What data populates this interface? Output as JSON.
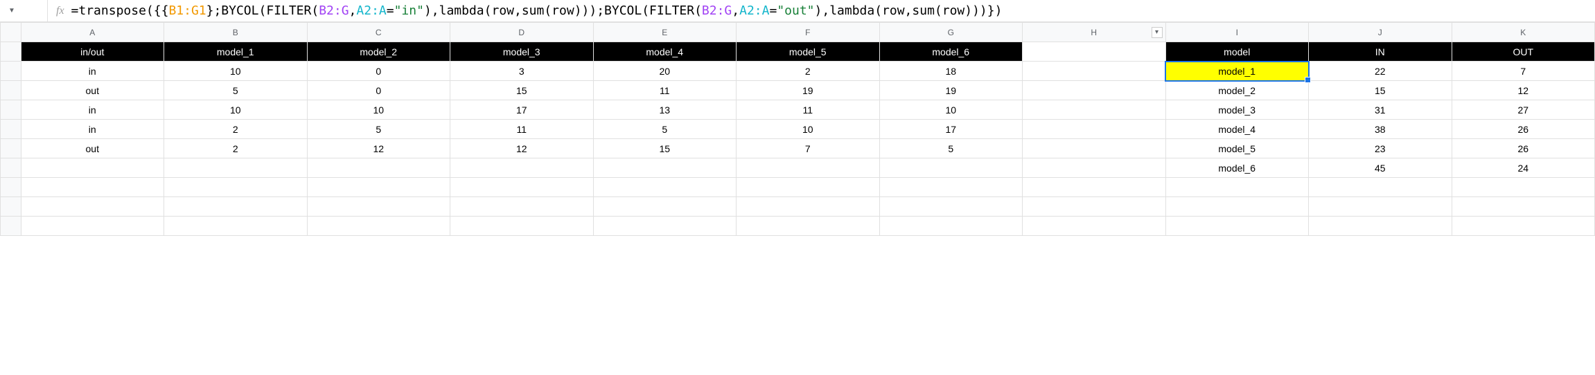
{
  "formula_bar": {
    "fx_label": "fx",
    "tokens": [
      {
        "t": "=transpose({{",
        "c": ""
      },
      {
        "t": "B1:G1",
        "c": "tok-orange"
      },
      {
        "t": "};BYCOL(FILTER(",
        "c": ""
      },
      {
        "t": "B2:G",
        "c": "tok-purple"
      },
      {
        "t": ",",
        "c": ""
      },
      {
        "t": "A2:A",
        "c": "tok-teal"
      },
      {
        "t": "=",
        "c": ""
      },
      {
        "t": "\"in\"",
        "c": "tok-green"
      },
      {
        "t": "),lambda(row,sum(row)));BYCOL(FILTER(",
        "c": ""
      },
      {
        "t": "B2:G",
        "c": "tok-purple"
      },
      {
        "t": ",",
        "c": ""
      },
      {
        "t": "A2:A",
        "c": "tok-teal"
      },
      {
        "t": "=",
        "c": ""
      },
      {
        "t": "\"out\"",
        "c": "tok-green"
      },
      {
        "t": "),lambda(row,sum(row)))})",
        "c": ""
      }
    ]
  },
  "columns": [
    "A",
    "B",
    "C",
    "D",
    "E",
    "F",
    "G",
    "H",
    "I",
    "J",
    "K"
  ],
  "header_row_left": [
    "in/out",
    "model_1",
    "model_2",
    "model_3",
    "model_4",
    "model_5",
    "model_6"
  ],
  "header_row_right": [
    "model",
    "IN",
    "OUT"
  ],
  "data_left": [
    [
      "in",
      "10",
      "0",
      "3",
      "20",
      "2",
      "18"
    ],
    [
      "out",
      "5",
      "0",
      "15",
      "11",
      "19",
      "19"
    ],
    [
      "in",
      "10",
      "10",
      "17",
      "13",
      "11",
      "10"
    ],
    [
      "in",
      "2",
      "5",
      "11",
      "5",
      "10",
      "17"
    ],
    [
      "out",
      "2",
      "12",
      "12",
      "15",
      "7",
      "5"
    ]
  ],
  "data_right": [
    [
      "model_1",
      "22",
      "7"
    ],
    [
      "model_2",
      "15",
      "12"
    ],
    [
      "model_3",
      "31",
      "27"
    ],
    [
      "model_4",
      "38",
      "26"
    ],
    [
      "model_5",
      "23",
      "26"
    ],
    [
      "model_6",
      "45",
      "24"
    ]
  ],
  "active_cell": {
    "row": 0,
    "col": 0,
    "side": "right"
  },
  "chart_data": {
    "type": "table",
    "title": "in/out totals by model",
    "columns": [
      "model",
      "IN",
      "OUT"
    ],
    "rows": [
      {
        "model": "model_1",
        "IN": 22,
        "OUT": 7
      },
      {
        "model": "model_2",
        "IN": 15,
        "OUT": 12
      },
      {
        "model": "model_3",
        "IN": 31,
        "OUT": 27
      },
      {
        "model": "model_4",
        "IN": 38,
        "OUT": 26
      },
      {
        "model": "model_5",
        "IN": 23,
        "OUT": 26
      },
      {
        "model": "model_6",
        "IN": 45,
        "OUT": 24
      }
    ]
  }
}
